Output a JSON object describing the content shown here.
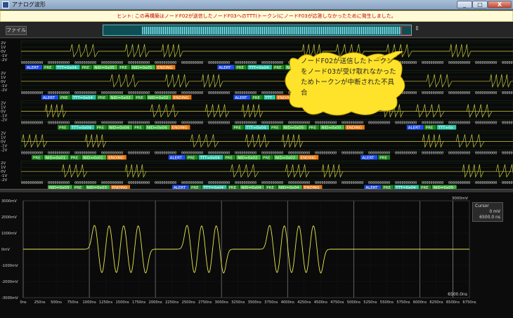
{
  "window": {
    "title": "アナログ波形",
    "min_label": "_",
    "max_label": "□",
    "close_label": "X"
  },
  "hint": "ヒント: この再構築はノードF02が送信したノードF03へのTTT(トークン)にノードF03が応答しなかったために発生しました。",
  "toolbar": {
    "file_label": "ファイル",
    "scroll_arrow": "⇕"
  },
  "callout": "ノードF02が送信したトークンをノード03が受け取れなかったためトークンが中断された不具合",
  "digital_traces": {
    "y_labels": [
      "2V",
      "1V",
      "0V",
      "-1V",
      "-2V"
    ],
    "hex_pattern": "0000000000",
    "bit_pattern": "111",
    "rows": [
      {
        "labels": [
          {
            "text": "ALERT",
            "kind": "alert"
          },
          {
            "text": "PRE",
            "kind": "pre"
          },
          {
            "text": "TTT=0x04",
            "kind": "ttt"
          },
          {
            "text": "PRE",
            "kind": "pre"
          },
          {
            "text": "NID=0x05",
            "kind": "nid"
          },
          {
            "text": "PRE",
            "kind": "pre"
          },
          {
            "text": "NID=0x05",
            "kind": "nid"
          },
          {
            "text": "ENDING",
            "kind": "end"
          },
          {
            "text": "ALERT",
            "kind": "alert"
          },
          {
            "text": "PRE",
            "kind": "pre"
          },
          {
            "text": "TTT=0x04",
            "kind": "ttt"
          },
          {
            "text": "PRE",
            "kind": "pre"
          },
          {
            "text": "NID=0x03",
            "kind": "nid"
          },
          {
            "text": "PRE",
            "kind": "pre"
          },
          {
            "text": "NID=0x03",
            "kind": "nid"
          },
          {
            "text": "ENDING",
            "kind": "end"
          }
        ]
      },
      {
        "labels": [
          {
            "text": "ALERT",
            "kind": "alert"
          },
          {
            "text": "PRE",
            "kind": "pre"
          },
          {
            "text": "TTT=0x04",
            "kind": "ttt"
          },
          {
            "text": "PRE",
            "kind": "pre"
          },
          {
            "text": "NID=0x02",
            "kind": "nid"
          },
          {
            "text": "PRE",
            "kind": "pre"
          },
          {
            "text": "NID=0x02",
            "kind": "nid"
          },
          {
            "text": "ENDING",
            "kind": "end"
          },
          {
            "text": "ALERT",
            "kind": "alert"
          },
          {
            "text": "PRE",
            "kind": "pre"
          },
          {
            "text": "TTT",
            "kind": "ttt"
          },
          {
            "text": "ENDING",
            "kind": "end"
          },
          {
            "text": "ALERT",
            "kind": "alert"
          }
        ]
      },
      {
        "labels": [
          {
            "text": "PRE",
            "kind": "pre"
          },
          {
            "text": "TTT=0x04",
            "kind": "ttt"
          },
          {
            "text": "PRE",
            "kind": "pre"
          },
          {
            "text": "NID=0x04",
            "kind": "nid"
          },
          {
            "text": "PRE",
            "kind": "pre"
          },
          {
            "text": "NID=0x04",
            "kind": "nid"
          },
          {
            "text": "ENDING",
            "kind": "end"
          },
          {
            "text": "PRE",
            "kind": "pre"
          },
          {
            "text": "TTT=0x04",
            "kind": "ttt"
          },
          {
            "text": "PRE",
            "kind": "pre"
          },
          {
            "text": "NID=0x05",
            "kind": "nid"
          },
          {
            "text": "PRE",
            "kind": "pre"
          },
          {
            "text": "NID=0x05",
            "kind": "nid"
          },
          {
            "text": "ENDING",
            "kind": "end"
          },
          {
            "text": "ALERT",
            "kind": "alert"
          },
          {
            "text": "PRE",
            "kind": "pre"
          },
          {
            "text": "TTT=0x",
            "kind": "ttt"
          }
        ]
      },
      {
        "labels": [
          {
            "text": "PRE",
            "kind": "pre"
          },
          {
            "text": "NID=0x01",
            "kind": "nid"
          },
          {
            "text": "PRE",
            "kind": "pre"
          },
          {
            "text": "NID=0x01",
            "kind": "nid"
          },
          {
            "text": "ENDING",
            "kind": "end"
          },
          {
            "text": "ALERT",
            "kind": "alert"
          },
          {
            "text": "PRE",
            "kind": "pre"
          },
          {
            "text": "TTT=0x04",
            "kind": "ttt"
          },
          {
            "text": "PRE",
            "kind": "pre"
          },
          {
            "text": "NID=0x02",
            "kind": "nid"
          },
          {
            "text": "PRE",
            "kind": "pre"
          },
          {
            "text": "NID=0x02",
            "kind": "nid"
          },
          {
            "text": "ENDING",
            "kind": "end"
          },
          {
            "text": "ALERT",
            "kind": "alert"
          },
          {
            "text": "PRE",
            "kind": "pre"
          }
        ]
      },
      {
        "labels": [
          {
            "text": "NID=0x03",
            "kind": "nid"
          },
          {
            "text": "PRE",
            "kind": "pre"
          },
          {
            "text": "NID=0x03",
            "kind": "nid"
          },
          {
            "text": "ENDING",
            "kind": "end"
          },
          {
            "text": "ALERT",
            "kind": "alert"
          },
          {
            "text": "PRE",
            "kind": "pre"
          },
          {
            "text": "TTT=0x04",
            "kind": "ttt"
          },
          {
            "text": "PRE",
            "kind": "pre"
          },
          {
            "text": "NID=0x04",
            "kind": "nid"
          },
          {
            "text": "PRE",
            "kind": "pre"
          },
          {
            "text": "NID=0x04",
            "kind": "nid"
          },
          {
            "text": "ENDING",
            "kind": "end"
          },
          {
            "text": "ALERT",
            "kind": "alert"
          },
          {
            "text": "PRE",
            "kind": "pre"
          },
          {
            "text": "TTT=0x04",
            "kind": "ttt"
          },
          {
            "text": "PRE",
            "kind": "pre"
          },
          {
            "text": "NID=0x05",
            "kind": "nid"
          }
        ]
      }
    ],
    "colors": {
      "alert": "#1f4ff0",
      "pre": "#1a8a1a",
      "ttt": "#2cc9a8",
      "nid": "#3db83d",
      "end": "#e87a10",
      "trace": "#c8c840"
    }
  },
  "analog": {
    "top_value": "3000mV",
    "cursor": {
      "title": "Cursor",
      "value": "0 mV",
      "time": "6500.0 ns"
    },
    "end_time": "6500.0ns",
    "y_ticks": [
      "3000mV",
      "2000mV",
      "1000mV",
      "0mV",
      "-1000mV",
      "-2000mV",
      "-3000mV"
    ],
    "x_ticks": [
      "0ns",
      "250ns",
      "500ns",
      "750ns",
      "1000ns",
      "1250ns",
      "1500ns",
      "1750ns",
      "2000ns",
      "2250ns",
      "2500ns",
      "2750ns",
      "3000ns",
      "3250ns",
      "3500ns",
      "3750ns",
      "4000ns",
      "4250ns",
      "4500ns",
      "4750ns",
      "5000ns",
      "5250ns",
      "5500ns",
      "5750ns",
      "6000ns",
      "6250ns",
      "6500ns",
      "6750ns"
    ],
    "trace_color": "#e8e850"
  }
}
